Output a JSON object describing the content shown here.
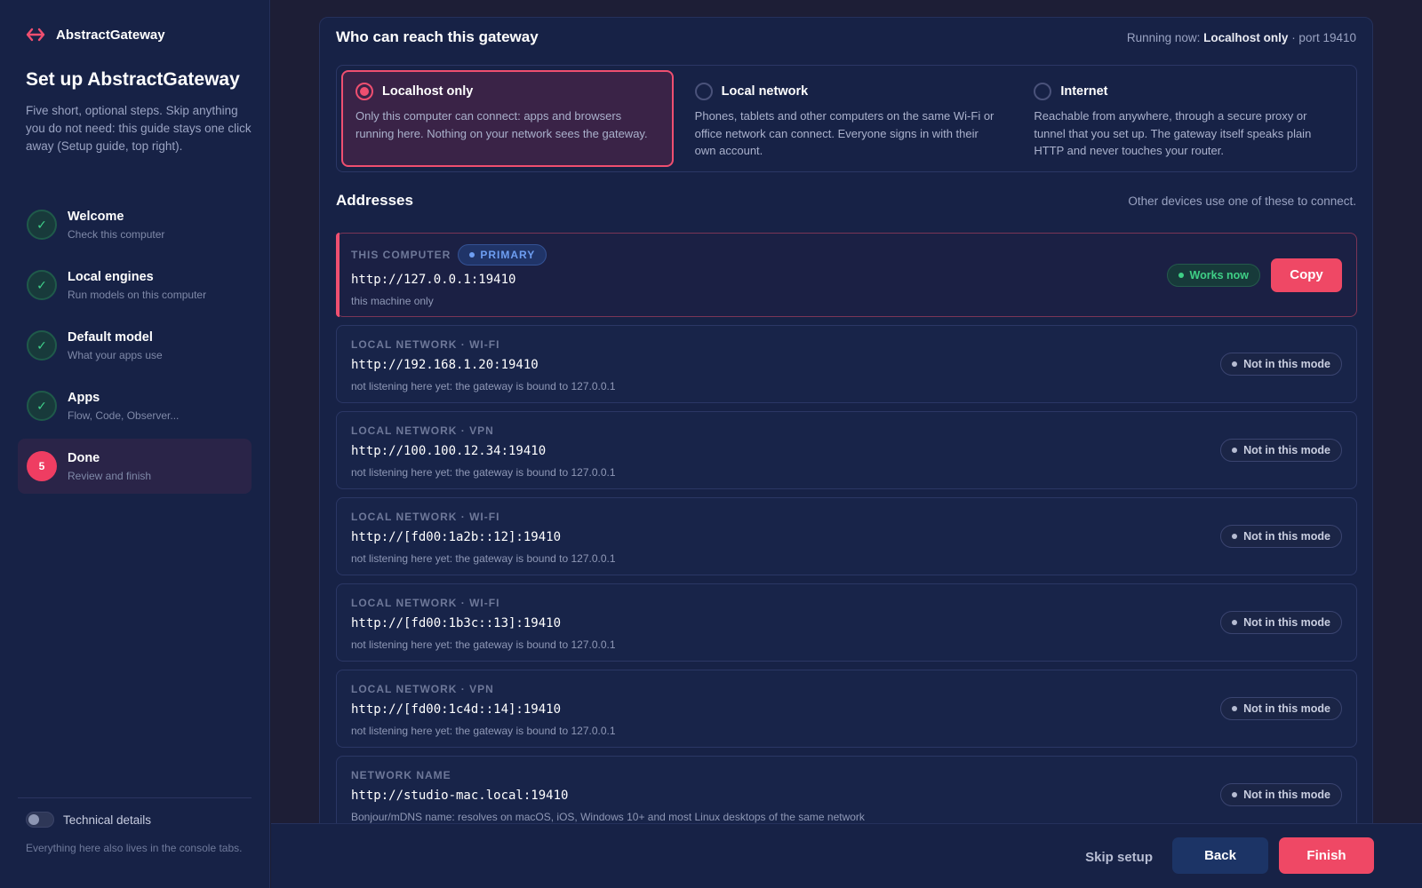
{
  "brand": {
    "name": "AbstractGateway",
    "icon": "double-arrow-icon",
    "accent": "#ef4f70"
  },
  "sidebar": {
    "title": "Set up AbstractGateway",
    "description": "Five short, optional steps. Skip anything you do not need: this guide stays one click away (Setup guide, top right).",
    "steps": [
      {
        "name": "Welcome",
        "sub": "Check this computer",
        "state": "done",
        "mark": "✓"
      },
      {
        "name": "Local engines",
        "sub": "Run models on this computer",
        "state": "done",
        "mark": "✓"
      },
      {
        "name": "Default model",
        "sub": "What your apps use",
        "state": "done",
        "mark": "✓"
      },
      {
        "name": "Apps",
        "sub": "Flow, Code, Observer...",
        "state": "done",
        "mark": "✓"
      },
      {
        "name": "Done",
        "sub": "Review and finish",
        "state": "active",
        "mark": "5"
      }
    ],
    "technical_toggle": {
      "label": "Technical details",
      "on": false
    },
    "footer_note": "Everything here also lives in the console tabs."
  },
  "reach": {
    "title": "Who can reach this gateway",
    "running_prefix": "Running now: ",
    "running_mode": "Localhost only",
    "running_suffix": " · port 19410",
    "modes": [
      {
        "name": "Localhost only",
        "desc": "Only this computer can connect: apps and browsers running here. Nothing on your network sees the gateway.",
        "selected": true
      },
      {
        "name": "Local network",
        "desc": "Phones, tablets and other computers on the same Wi-Fi or office network can connect. Everyone signs in with their own account.",
        "selected": false
      },
      {
        "name": "Internet",
        "desc": "Reachable from anywhere, through a secure proxy or tunnel that you set up. The gateway itself speaks plain HTTP and never touches your router.",
        "selected": false
      }
    ]
  },
  "addresses": {
    "title": "Addresses",
    "note": "Other devices use one of these to connect.",
    "primary": {
      "label": "THIS COMPUTER",
      "badge": "PRIMARY",
      "url": "http://127.0.0.1:19410",
      "sub": "this machine only",
      "status": "Works now",
      "copy_label": "Copy"
    },
    "rows": [
      {
        "label": "LOCAL NETWORK · WI-FI",
        "url": "http://192.168.1.20:19410",
        "sub": "not listening here yet: the gateway is bound to 127.0.0.1",
        "status": "Not in this mode"
      },
      {
        "label": "LOCAL NETWORK · VPN",
        "url": "http://100.100.12.34:19410",
        "sub": "not listening here yet: the gateway is bound to 127.0.0.1",
        "status": "Not in this mode"
      },
      {
        "label": "LOCAL NETWORK · WI-FI",
        "url": "http://[fd00:1a2b::12]:19410",
        "sub": "not listening here yet: the gateway is bound to 127.0.0.1",
        "status": "Not in this mode"
      },
      {
        "label": "LOCAL NETWORK · WI-FI",
        "url": "http://[fd00:1b3c::13]:19410",
        "sub": "not listening here yet: the gateway is bound to 127.0.0.1",
        "status": "Not in this mode"
      },
      {
        "label": "LOCAL NETWORK · VPN",
        "url": "http://[fd00:1c4d::14]:19410",
        "sub": "not listening here yet: the gateway is bound to 127.0.0.1",
        "status": "Not in this mode"
      },
      {
        "label": "NETWORK NAME",
        "url": "http://studio-mac.local:19410",
        "sub": "Bonjour/mDNS name: resolves on macOS, iOS, Windows 10+ and most Linux desktops of the same network",
        "status": "Not in this mode"
      }
    ]
  },
  "footer": {
    "skip_label": "Skip setup",
    "back_label": "Back",
    "finish_label": "Finish"
  }
}
